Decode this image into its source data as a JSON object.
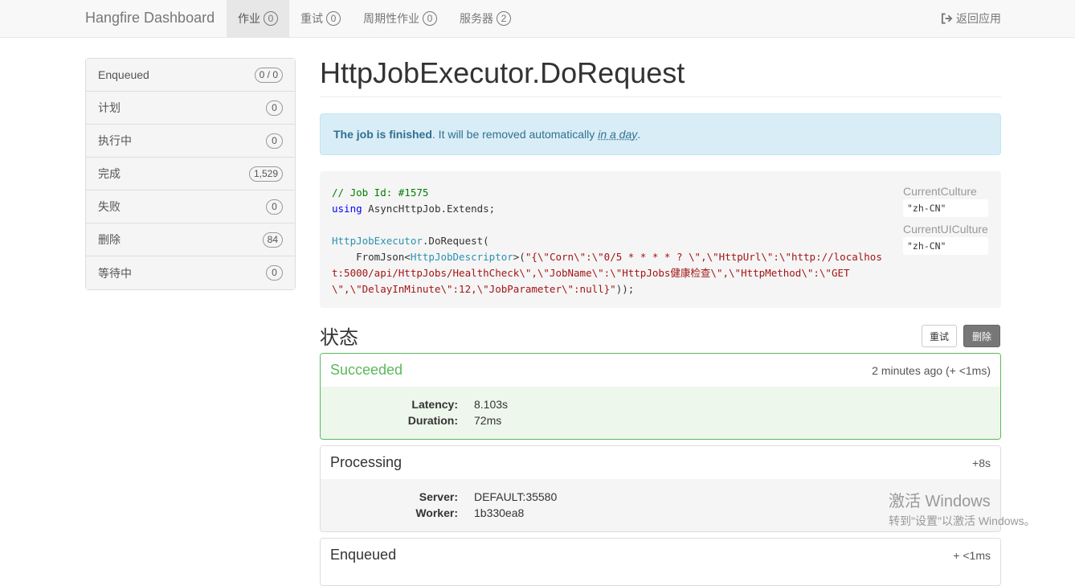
{
  "navbar": {
    "brand": "Hangfire Dashboard",
    "items": [
      {
        "label": "作业",
        "count": "0"
      },
      {
        "label": "重试",
        "count": "0"
      },
      {
        "label": "周期性作业",
        "count": "0"
      },
      {
        "label": "服务器",
        "count": "2"
      }
    ],
    "back_label": "返回应用"
  },
  "sidebar": {
    "items": [
      {
        "label": "Enqueued",
        "count": "0 / 0"
      },
      {
        "label": "计划",
        "count": "0"
      },
      {
        "label": "执行中",
        "count": "0"
      },
      {
        "label": "完成",
        "count": "1,529"
      },
      {
        "label": "失败",
        "count": "0"
      },
      {
        "label": "删除",
        "count": "84"
      },
      {
        "label": "等待中",
        "count": "0"
      }
    ]
  },
  "job": {
    "title": "HttpJobExecutor.DoRequest",
    "alert_bold": "The job is finished",
    "alert_text": ". It will be removed automatically",
    "alert_rel": "in a day",
    "alert_end": "."
  },
  "code": {
    "comment": "// Job Id: #1575",
    "using_kw": "using",
    "using_rest": " AsyncHttpJob.Extends;",
    "call_type": "HttpJobExecutor",
    "call_rest": ".DoRequest(",
    "fromjson": "    FromJson<",
    "descriptor": "HttpJobDescriptor",
    "gt": ">(",
    "str1": "\"{\\\"Corn\\\":\\\"0/5 * * * * ? \\\",\\\"HttpUrl\\\":\\\"http://localhos",
    "str2": "t:5000/api/HttpJobs/HealthCheck\\\",\\\"JobName\\\":\\\"HttpJobs健康检查\\\",\\\"HttpMethod\\\":\\\"GET",
    "str3": "\\\",\\\"DelayInMinute\\\":12,\\\"JobParameter\\\":null}\"",
    "end3": "));"
  },
  "culture": {
    "current_culture_label": "CurrentCulture",
    "current_culture_value": "\"zh-CN\"",
    "current_ui_culture_label": "CurrentUICulture",
    "current_ui_culture_value": "\"zh-CN\""
  },
  "state": {
    "title": "状态",
    "retry_label": "重试",
    "delete_label": "删除"
  },
  "history": [
    {
      "name": "Succeeded",
      "time": "2 minutes ago (+ <1ms)",
      "fields": [
        {
          "key": "Latency:",
          "value": "8.103s"
        },
        {
          "key": "Duration:",
          "value": "72ms"
        }
      ]
    },
    {
      "name": "Processing",
      "time": "+8s",
      "fields": [
        {
          "key": "Server:",
          "value": "DEFAULT:35580"
        },
        {
          "key": "Worker:",
          "value": "1b330ea8"
        }
      ]
    },
    {
      "name": "Enqueued",
      "time": "+ <1ms"
    }
  ],
  "watermark": {
    "title": "激活 Windows",
    "subtitle": "转到\"设置\"以激活 Windows。"
  },
  "colors": {
    "success": "#5cb85c",
    "info_bg": "#d9edf7",
    "info_text": "#31708f"
  }
}
